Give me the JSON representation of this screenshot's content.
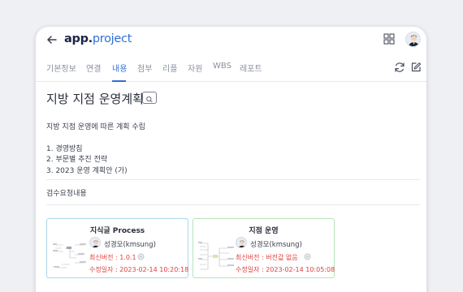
{
  "app": {
    "logo_app": "app.",
    "logo_project": "project"
  },
  "tabs": [
    {
      "label": "기본정보"
    },
    {
      "label": "연결"
    },
    {
      "label": "내용"
    },
    {
      "label": "첨부"
    },
    {
      "label": "리플"
    },
    {
      "label": "자원"
    },
    {
      "label": "WBS"
    },
    {
      "label": "레포트"
    }
  ],
  "active_tab": "내용",
  "page": {
    "title": "지방 지점 운영계획"
  },
  "content": {
    "summary": "지방 지점 운영에 따른 계획 수립",
    "items": [
      "1. 경영방침",
      "2. 부문별 추진 전략",
      "3. 2023 운영 계획안 (가)"
    ],
    "review_label": "검수요청내용"
  },
  "cards": [
    {
      "title": "지식글 Process",
      "author": "성경모(kmsung)",
      "version": "최신버전 : 1.0.1",
      "modified": "수정일자 : 2023-02-14 10:20:18"
    },
    {
      "title": "지점 운영",
      "author": "성경모(kmsung)",
      "version": "최신버전 : 버전값 없음",
      "modified": "수정일자 : 2023-02-14 10:05:08"
    }
  ],
  "colors": {
    "accent": "#2f6fd6",
    "brand_dark": "#1c2346",
    "warning": "#e04040",
    "card_blue_border": "#a8d8e6",
    "card_green_border": "#b6e3b9"
  }
}
